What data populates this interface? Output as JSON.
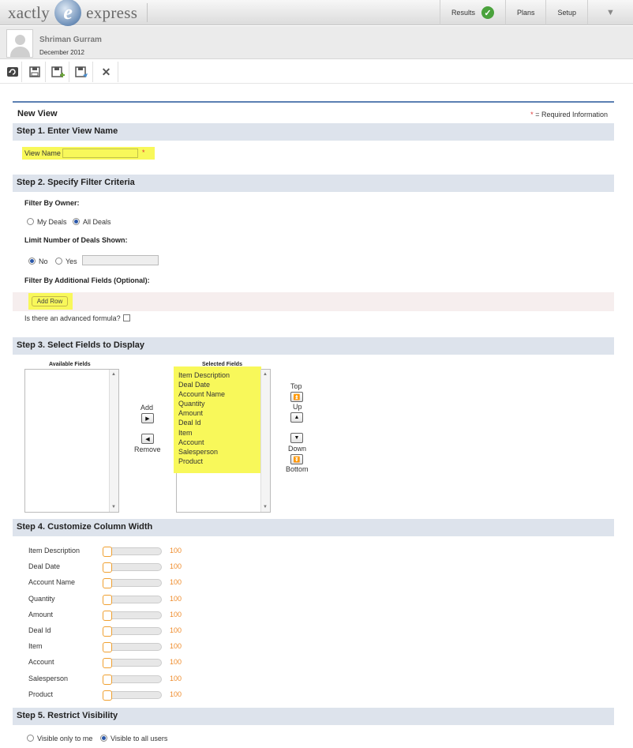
{
  "app": {
    "logo_left": "xactly",
    "logo_mark": "e",
    "logo_right": "express",
    "nav": [
      {
        "label": "Results",
        "badge": "check"
      },
      {
        "label": "Plans"
      },
      {
        "label": "Setup"
      }
    ],
    "nav_menu_icon": "▼"
  },
  "user": {
    "name": "Shriman Gurram",
    "period": "December 2012"
  },
  "toolbar": {
    "buttons": [
      "refresh-icon",
      "save-icon",
      "save-new-icon",
      "save-as-icon",
      "close-icon"
    ],
    "close_glyph": "✕"
  },
  "form": {
    "title": "New View",
    "required_star": "*",
    "required_note": "= Required Information",
    "step1": {
      "title": "Step 1. Enter View Name",
      "field_label": "View Name",
      "field_value": "",
      "star": "*"
    },
    "step2": {
      "title": "Step 2. Specify Filter Criteria",
      "owner_label": "Filter By Owner:",
      "owner_options": [
        "My Deals",
        "All Deals"
      ],
      "owner_selected": "All Deals",
      "limit_label": "Limit Number of Deals Shown:",
      "limit_options": [
        "No",
        "Yes"
      ],
      "limit_selected": "No",
      "limit_value": "",
      "additional_label": "Filter By Additional Fields (Optional):",
      "add_row_label": "Add Row",
      "advanced_label": "Is there an advanced formula?",
      "advanced_checked": false
    },
    "step3": {
      "title": "Step 3. Select Fields to Display",
      "available_label": "Available Fields",
      "available_fields": [],
      "selected_label": "Selected Fields",
      "selected_fields": [
        "Item Description",
        "Deal Date",
        "Account Name",
        "Quantity",
        "Amount",
        "Deal Id",
        "Item",
        "Account",
        "Salesperson",
        "Product"
      ],
      "add_label": "Add",
      "remove_label": "Remove",
      "top_label": "Top",
      "up_label": "Up",
      "down_label": "Down",
      "bottom_label": "Bottom"
    },
    "step4": {
      "title": "Step 4. Customize Column Width",
      "columns": [
        {
          "name": "Item Description",
          "width": "100"
        },
        {
          "name": "Deal Date",
          "width": "100"
        },
        {
          "name": "Account Name",
          "width": "100"
        },
        {
          "name": "Quantity",
          "width": "100"
        },
        {
          "name": "Amount",
          "width": "100"
        },
        {
          "name": "Deal Id",
          "width": "100"
        },
        {
          "name": "Item",
          "width": "100"
        },
        {
          "name": "Account",
          "width": "100"
        },
        {
          "name": "Salesperson",
          "width": "100"
        },
        {
          "name": "Product",
          "width": "100"
        }
      ]
    },
    "step5": {
      "title": "Step 5. Restrict Visibility",
      "options": [
        "Visible only to me",
        "Visible to all users"
      ],
      "selected": "Visible to all users"
    }
  },
  "colors": {
    "accent": "#5b7fb2",
    "step_bg": "#dde3ec",
    "highlight": "#f8f85a",
    "slider_value": "#ef8c2c",
    "results_check": "#4aa23c"
  }
}
